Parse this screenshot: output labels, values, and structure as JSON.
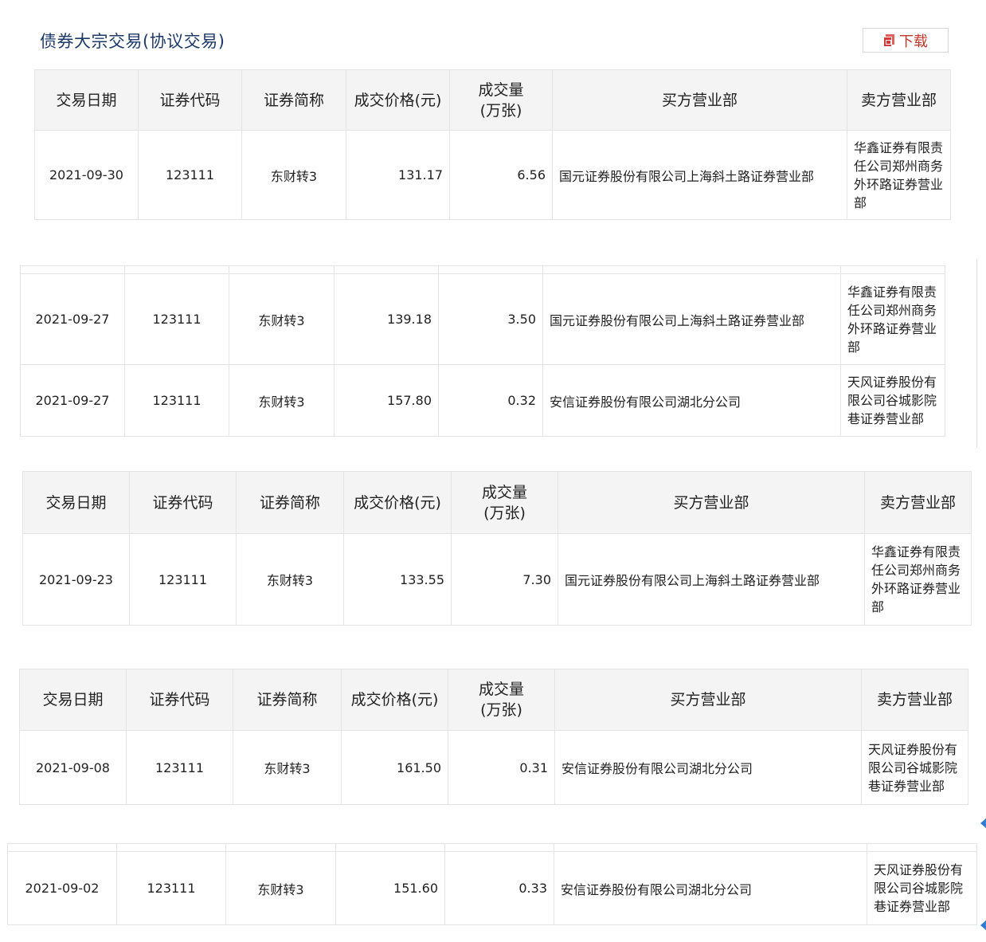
{
  "page_title": "债券大宗交易(协议交易)",
  "download_label": "下载",
  "headers": {
    "date": "交易日期",
    "code": "证券代码",
    "name": "证券简称",
    "price": "成交价格(元)",
    "volume_line1": "成交量",
    "volume_line2": "(万张)",
    "buyer": "买方营业部",
    "seller": "卖方营业部"
  },
  "table1": {
    "rows": [
      {
        "date": "2021-09-30",
        "code": "123111",
        "name": "东财转3",
        "price": "131.17",
        "volume": "6.56",
        "buyer": "国元证券股份有限公司上海斜土路证券营业部",
        "seller": "华鑫证券有限责任公司郑州商务外环路证券营业部"
      }
    ]
  },
  "table2": {
    "rows": [
      {
        "date": "2021-09-27",
        "code": "123111",
        "name": "东财转3",
        "price": "139.18",
        "volume": "3.50",
        "buyer": "国元证券股份有限公司上海斜土路证券营业部",
        "seller": "华鑫证券有限责任公司郑州商务外环路证券营业部"
      },
      {
        "date": "2021-09-27",
        "code": "123111",
        "name": "东财转3",
        "price": "157.80",
        "volume": "0.32",
        "buyer": "安信证券股份有限公司湖北分公司",
        "seller": "天风证券股份有限公司谷城影院巷证券营业部"
      }
    ]
  },
  "table3": {
    "rows": [
      {
        "date": "2021-09-23",
        "code": "123111",
        "name": "东财转3",
        "price": "133.55",
        "volume": "7.30",
        "buyer": "国元证券股份有限公司上海斜土路证券营业部",
        "seller": "华鑫证券有限责任公司郑州商务外环路证券营业部"
      }
    ]
  },
  "table4": {
    "rows": [
      {
        "date": "2021-09-08",
        "code": "123111",
        "name": "东财转3",
        "price": "161.50",
        "volume": "0.31",
        "buyer": "安信证券股份有限公司湖北分公司",
        "seller": "天风证券股份有限公司谷城影院巷证券营业部"
      }
    ]
  },
  "table5": {
    "rows": [
      {
        "date": "2021-09-02",
        "code": "123111",
        "name": "东财转3",
        "price": "151.60",
        "volume": "0.33",
        "buyer": "安信证券股份有限公司湖北分公司",
        "seller": "天风证券股份有限公司谷城影院巷证券营业部"
      }
    ]
  },
  "icons": {
    "download": "pdf-download-icon",
    "scroll": "caret-left-icon"
  },
  "colors": {
    "title": "#1e3a68",
    "download": "#c0392b",
    "header_bg": "#f4f4f4",
    "border": "#e4e4e4",
    "arrow": "#2e7bd6"
  }
}
